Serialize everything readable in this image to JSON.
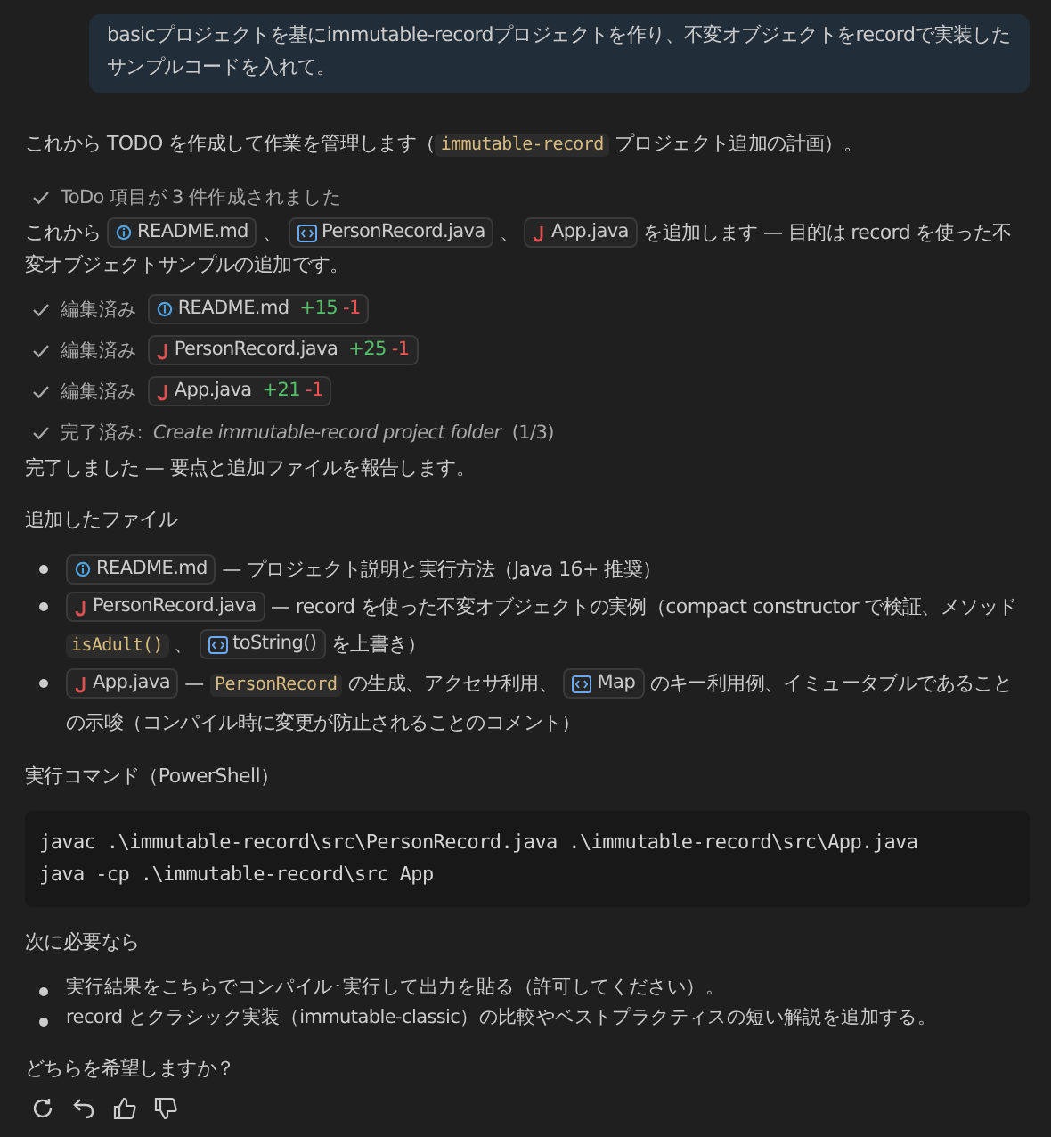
{
  "user_message": {
    "text": "basicプロジェクトを基にimmutable-recordプロジェクトを作り、不変オブジェクトをrecordで実装したサンプルコードを入れて。"
  },
  "intro": [
    {
      "kind": "text",
      "text": "これから TODO を作成して作業を管理します（"
    },
    {
      "kind": "code",
      "text": "immutable-record"
    },
    {
      "kind": "text",
      "text": " プロジェクト追加の計画）。"
    }
  ],
  "todo_status": {
    "text": "ToDo 項目が 3 件作成されました"
  },
  "plan": [
    {
      "kind": "text",
      "text": "これから "
    },
    {
      "kind": "readme",
      "text": "README.md"
    },
    {
      "kind": "text",
      "text": " 、 "
    },
    {
      "kind": "symbol",
      "text": "PersonRecord.java"
    },
    {
      "kind": "text",
      "text": " 、 "
    },
    {
      "kind": "java",
      "text": "App.java"
    },
    {
      "kind": "text",
      "text": " を追加します — 目的は record を使った不変オブジェクトサンプルの追加です。"
    }
  ],
  "edits": [
    {
      "label": "編集済み",
      "kind": "readme",
      "file": "README.md",
      "added": "+15",
      "removed": "-1"
    },
    {
      "label": "編集済み",
      "kind": "java",
      "file": "PersonRecord.java",
      "added": "+25",
      "removed": "-1"
    },
    {
      "label": "編集済み",
      "kind": "java",
      "file": "App.java",
      "added": "+21",
      "removed": "-1"
    }
  ],
  "progress": {
    "label": "完了済み:",
    "task": "Create immutable-record project folder",
    "count": "(1/3)"
  },
  "done": "完了しました — 要点と追加ファイルを報告します。",
  "files_heading": "追加したファイル",
  "files": [
    [
      {
        "kind": "readme",
        "text": "README.md"
      },
      {
        "kind": "text",
        "text": " — プロジェクト説明と実行方法（Java 16+ 推奨）"
      }
    ],
    [
      {
        "kind": "java",
        "text": "PersonRecord.java"
      },
      {
        "kind": "text",
        "text": " — record を使った不変オブジェクトの実例（compact constructor で検証、メソッド "
      },
      {
        "kind": "code",
        "text": "isAdult()"
      },
      {
        "kind": "text",
        "text": " 、 "
      },
      {
        "kind": "symbol",
        "text": "toString()"
      },
      {
        "kind": "text",
        "text": " を上書き）"
      }
    ],
    [
      {
        "kind": "java",
        "text": "App.java"
      },
      {
        "kind": "text",
        "text": " — "
      },
      {
        "kind": "code",
        "text": "PersonRecord"
      },
      {
        "kind": "text",
        "text": " の生成、アクセサ利用、 "
      },
      {
        "kind": "symbol",
        "text": "Map"
      },
      {
        "kind": "text",
        "text": " のキー利用例、イミュータブルであることの示唆（コンパイル時に変更が防止されることのコメント）"
      }
    ]
  ],
  "command_heading": "実行コマンド（PowerShell）",
  "command_lines": [
    "javac .\\immutable-record\\src\\PersonRecord.java .\\immutable-record\\src\\App.java",
    "java -cp .\\immutable-record\\src App"
  ],
  "next_heading": "次に必要なら",
  "next_items": [
    "実行結果をこちらでコンパイル･実行して出力を貼る（許可してください）。",
    "record とクラシック実装（immutable-classic）の比較やベストプラクティスの短い解説を追加する。"
  ],
  "question": "どちらを希望しますか？"
}
